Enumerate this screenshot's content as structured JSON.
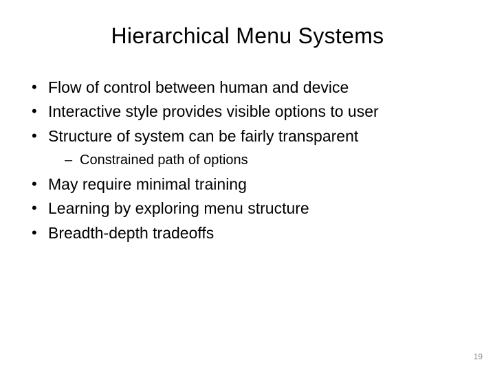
{
  "slide": {
    "title": "Hierarchical Menu Systems",
    "bullets": {
      "b0": "Flow of control between human and device",
      "b1": "Interactive style provides visible options to user",
      "b2": "Structure of system can be fairly transparent",
      "b2_sub0": "Constrained path of options",
      "b3": "May require minimal training",
      "b4": "Learning by exploring menu structure",
      "b5": "Breadth-depth tradeoffs"
    },
    "page_number": "19"
  }
}
